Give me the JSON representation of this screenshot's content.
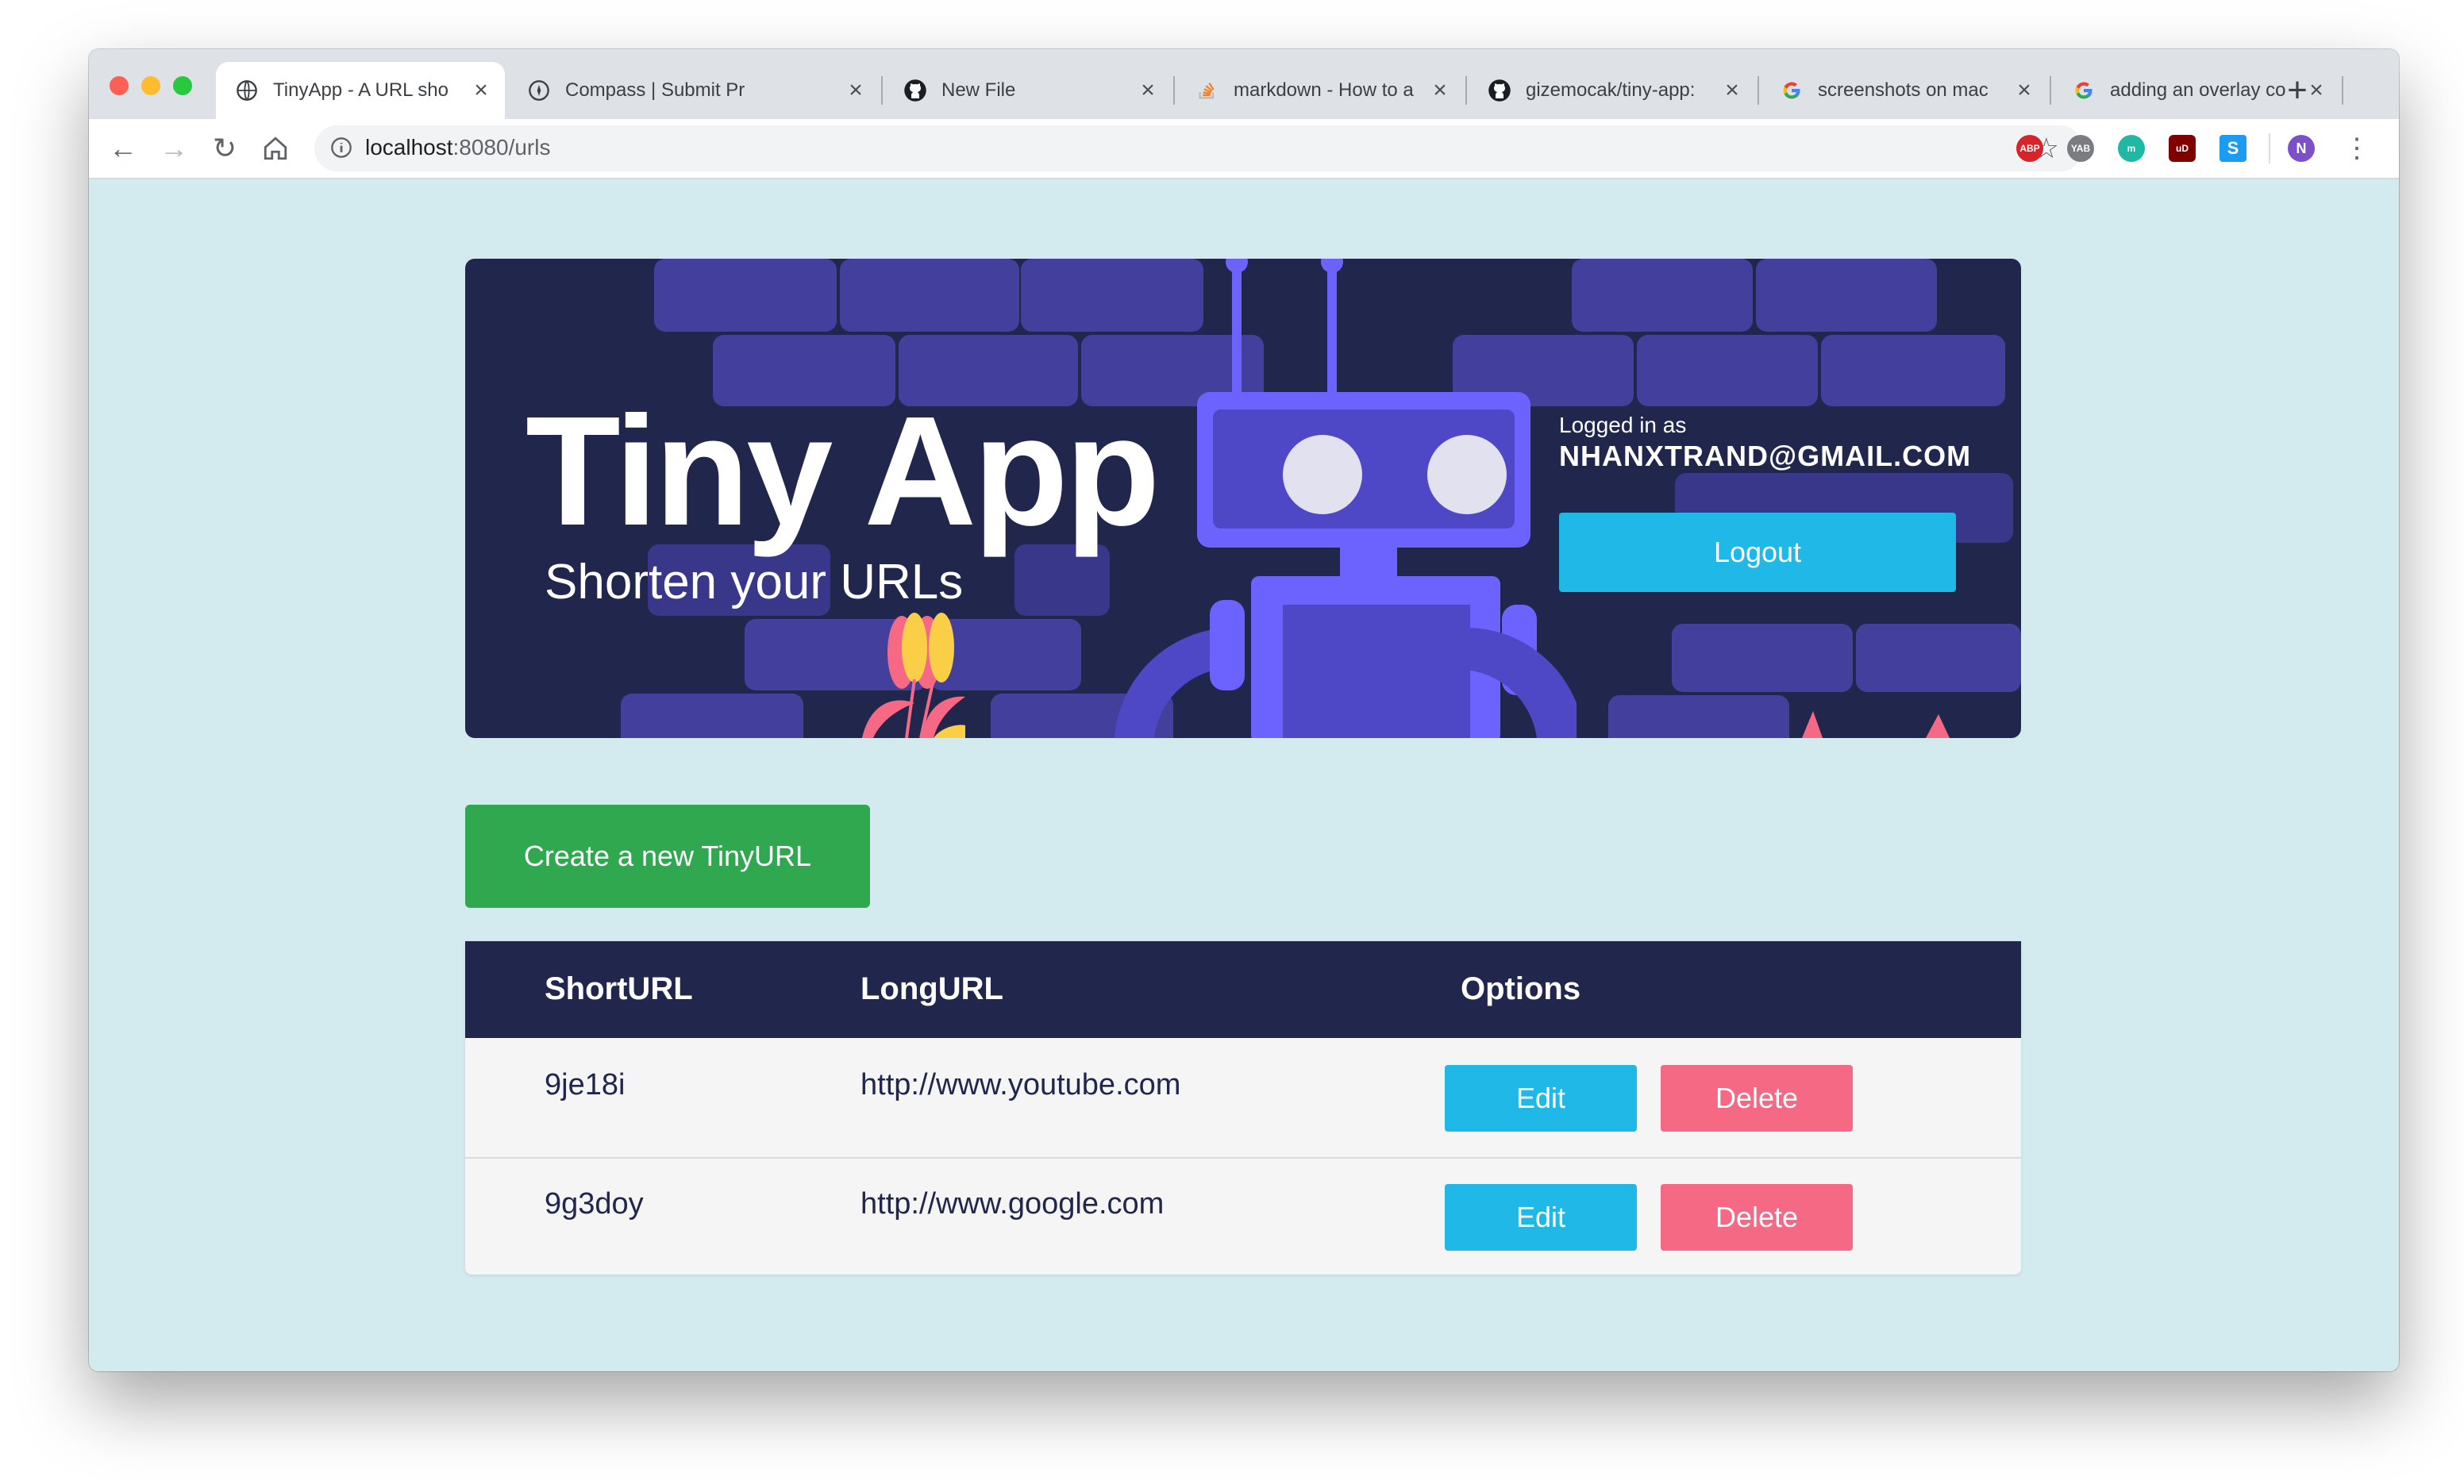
{
  "browser": {
    "tabs": [
      {
        "title": "TinyApp - A URL sho",
        "icon": "globe-icon",
        "active": true
      },
      {
        "title": "Compass | Submit Pr",
        "icon": "compass-icon",
        "active": false
      },
      {
        "title": "New File",
        "icon": "github-icon",
        "active": false
      },
      {
        "title": "markdown - How to a",
        "icon": "stackoverflow-icon",
        "active": false
      },
      {
        "title": "gizemocak/tiny-app:",
        "icon": "github-icon",
        "active": false
      },
      {
        "title": "screenshots on mac",
        "icon": "google-icon",
        "active": false
      },
      {
        "title": "adding an overlay co",
        "icon": "google-icon",
        "active": false
      }
    ],
    "url_host": "localhost",
    "url_rest": ":8080/urls",
    "extensions": [
      "ABP",
      "YAB",
      "m",
      "uD",
      "S"
    ],
    "profile_initial": "N"
  },
  "banner": {
    "title": "Tiny App",
    "subtitle": "Shorten your URLs",
    "login_label": "Logged in as",
    "login_email": "NHANXTRAND@GMAIL.COM",
    "logout_label": "Logout"
  },
  "actions": {
    "create_label": "Create a new TinyURL"
  },
  "table": {
    "headers": [
      "ShortURL",
      "LongURL",
      "Options"
    ],
    "rows": [
      {
        "short": "9je18i",
        "long": "http://www.youtube.com",
        "edit": "Edit",
        "delete": "Delete"
      },
      {
        "short": "9g3doy",
        "long": "http://www.google.com",
        "edit": "Edit",
        "delete": "Delete"
      }
    ]
  },
  "colors": {
    "page_bg": "#d3ebee",
    "banner_bg": "#21264d",
    "primary": "#1fb8e7",
    "success": "#2fa84f",
    "danger": "#f66985"
  }
}
